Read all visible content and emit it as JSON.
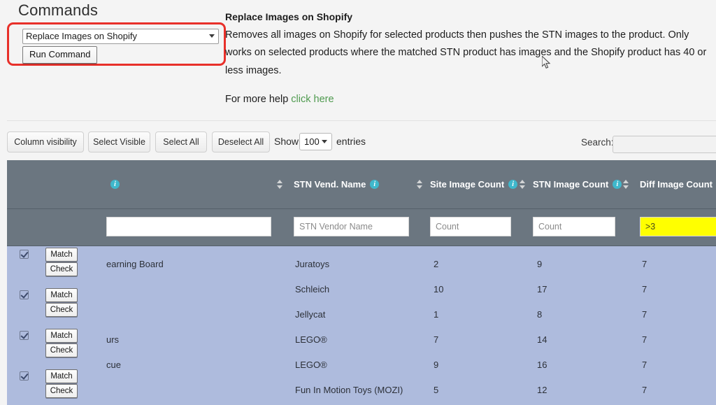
{
  "commands": {
    "title": "Commands",
    "selected_command": "Replace Images on Shopify",
    "run_label": "Run Command"
  },
  "description": {
    "title": "Replace Images on Shopify",
    "body": "Removes all images on Shopify for selected products then pushes the STN images to the product. Only works on selected products where the matched STN product has images and the Shopify product has 40 or less images.",
    "help_prefix": "For more help ",
    "help_link": "click here"
  },
  "toolbar": {
    "buttons": [
      "Column visibility",
      "Select Visible",
      "Select All",
      "Deselect All"
    ],
    "show_label": "Show",
    "page_length": "100",
    "entries_label": "entries",
    "search_label": "Search:",
    "search_value": ""
  },
  "table": {
    "columns": [
      {
        "label": "",
        "info": true,
        "sortable": true
      },
      {
        "label": "STN Vend. Name",
        "info": true,
        "sortable": true
      },
      {
        "label": "Site Image Count",
        "info": true,
        "sortable": true
      },
      {
        "label": "STN Image Count",
        "info": true,
        "sortable": true
      },
      {
        "label": "Diff Image Count",
        "info": true,
        "sortable": false
      }
    ],
    "filters": [
      {
        "value": "",
        "placeholder": "",
        "highlight": false
      },
      {
        "value": "",
        "placeholder": "STN Vendor Name",
        "highlight": false
      },
      {
        "value": "",
        "placeholder": "Count",
        "highlight": false
      },
      {
        "value": "",
        "placeholder": "Count",
        "highlight": false
      },
      {
        "value": ">3",
        "placeholder": "",
        "highlight": true
      }
    ],
    "row_buttons": {
      "match": "Match",
      "check": "Check"
    },
    "rows": [
      {
        "name": "earning Board",
        "vendor": "Juratoys",
        "site_image_count": "2",
        "stn_image_count": "9",
        "diff_image_count": "7"
      },
      {
        "name": "",
        "vendor": "Schleich",
        "site_image_count": "10",
        "stn_image_count": "17",
        "diff_image_count": "7"
      },
      {
        "name": "",
        "vendor": "Jellycat",
        "site_image_count": "1",
        "stn_image_count": "8",
        "diff_image_count": "7"
      },
      {
        "name": "urs",
        "vendor": "LEGO®",
        "site_image_count": "7",
        "stn_image_count": "14",
        "diff_image_count": "7"
      },
      {
        "name": "cue",
        "vendor": "LEGO®",
        "site_image_count": "9",
        "stn_image_count": "16",
        "diff_image_count": "7"
      },
      {
        "name": "",
        "vendor": "Fun In Motion Toys (MOZI)",
        "site_image_count": "5",
        "stn_image_count": "12",
        "diff_image_count": "7"
      }
    ]
  },
  "colors": {
    "header_bg": "#6b7680",
    "row_bg": "#aebbdd",
    "annotation": "#e8302a",
    "info_icon": "#3fb8cc",
    "highlight": "#ffff00",
    "link": "#4f9a4f"
  }
}
